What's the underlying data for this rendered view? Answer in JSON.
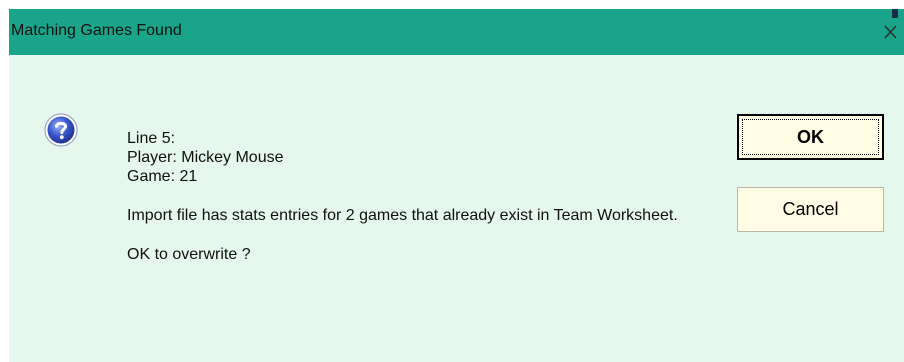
{
  "window": {
    "title": "Matching Games Found",
    "close_label": "Close"
  },
  "icon": "question-icon",
  "message": {
    "line": "Line 5:",
    "player": "Player: Mickey Mouse",
    "game": "Game: 21",
    "import_text": "Import file has stats entries for 2 games that already exist in Team Worksheet.",
    "prompt": "OK to overwrite ?"
  },
  "buttons": {
    "ok_label": "OK",
    "cancel_label": "Cancel"
  },
  "colors": {
    "titlebar": "#1aa58a",
    "body_background": "#e6f7ee",
    "button_background": "#fffde3"
  }
}
